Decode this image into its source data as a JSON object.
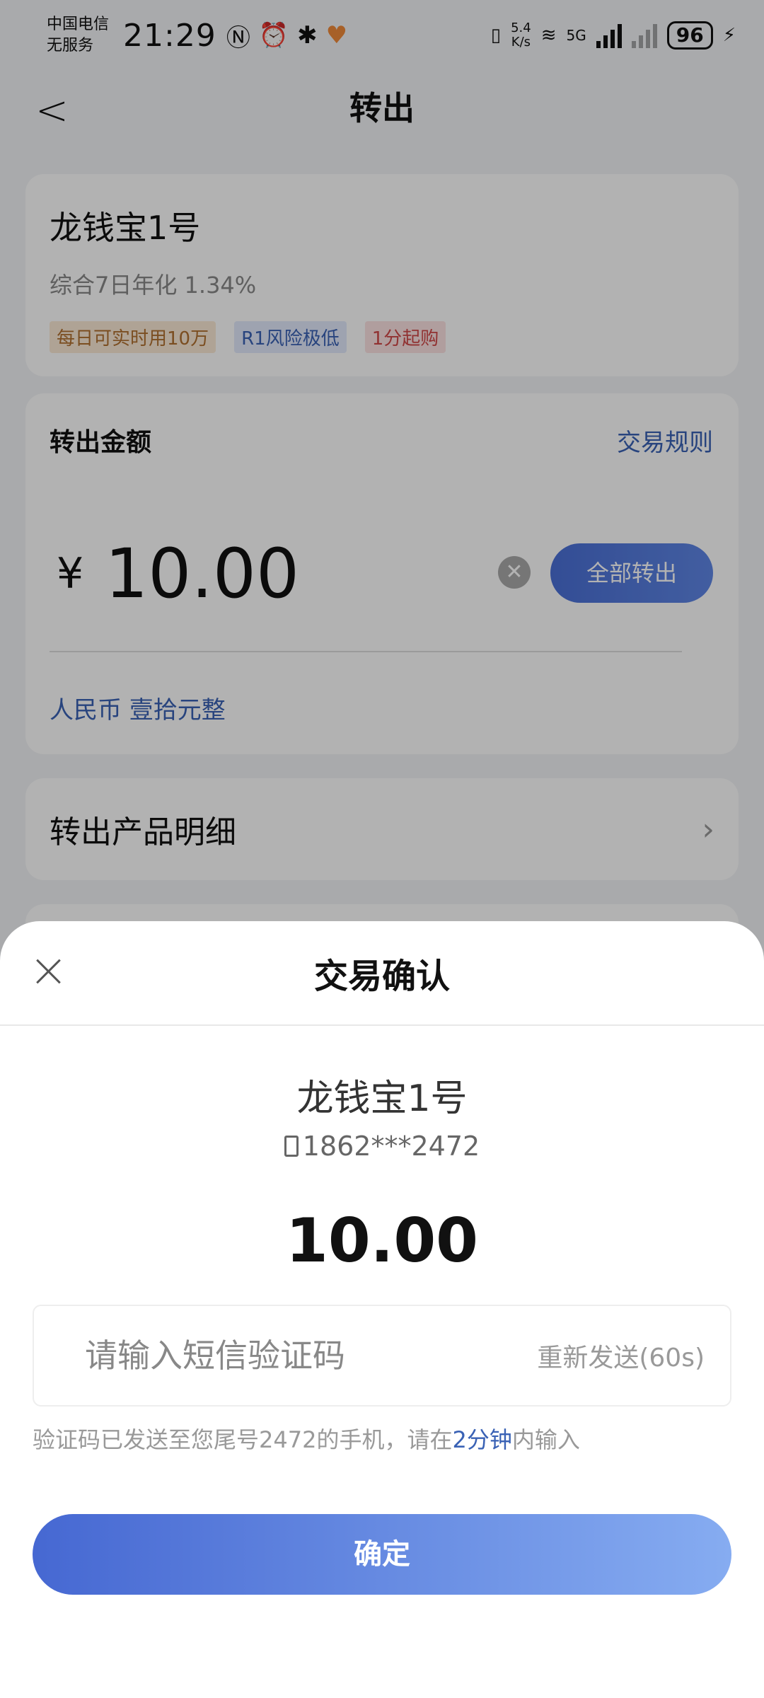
{
  "status_bar": {
    "carrier_line1": "中国电信",
    "carrier_line2": "无服务",
    "time": "21:29",
    "net_speed_value": "5.4",
    "net_speed_unit": "K/s",
    "network_type": "5G",
    "battery": "96"
  },
  "header": {
    "title": "转出"
  },
  "product_card": {
    "name": "龙钱宝1号",
    "rate": "综合7日年化 1.34%",
    "tags": [
      "每日可实时用10万",
      "R1风险极低",
      "1分起购"
    ]
  },
  "amount_card": {
    "label": "转出金额",
    "rules_link": "交易规则",
    "currency_symbol": "¥",
    "amount": "10.00",
    "all_button": "全部转出",
    "amount_in_words": "人民币 壹拾元整"
  },
  "detail_row": {
    "label": "转出产品明细"
  },
  "sheet": {
    "title": "交易确认",
    "product": "龙钱宝1号",
    "phone": "1862***2472",
    "amount": "10.00",
    "code_placeholder": "请输入短信验证码",
    "resend": "重新发送(60s)",
    "hint_before": "验证码已发送至您尾号2472的手机，请在",
    "hint_highlight": "2分钟",
    "hint_after": "内输入",
    "confirm_button": "确定"
  }
}
